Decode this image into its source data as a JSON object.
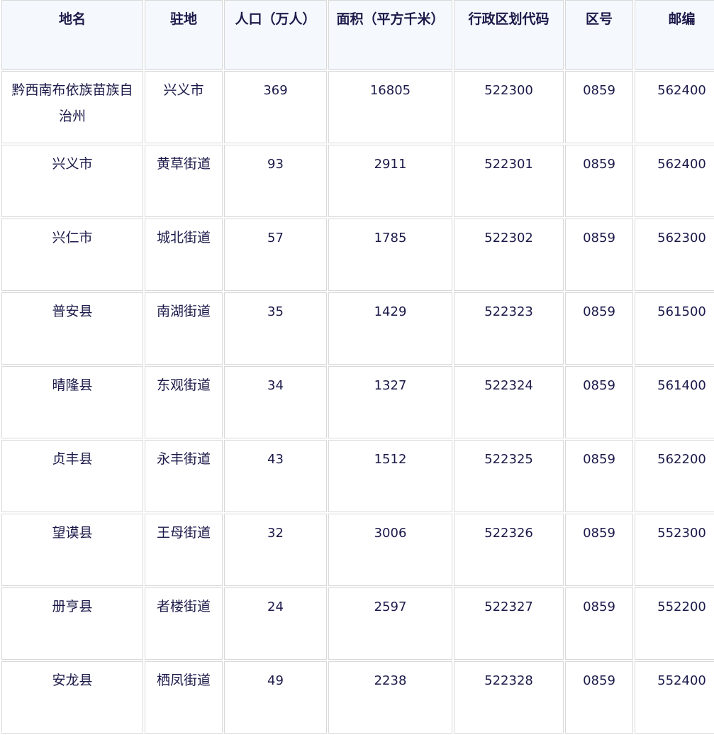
{
  "table": {
    "columns": [
      "地名",
      "驻地",
      "人口（万人）",
      "面积（平方千米）",
      "行政区划代码",
      "区号",
      "邮编"
    ],
    "rows": [
      [
        "黔西南布依族苗族自治州",
        "兴义市",
        "369",
        "16805",
        "522300",
        "0859",
        "562400"
      ],
      [
        "兴义市",
        "黄草街道",
        "93",
        "2911",
        "522301",
        "0859",
        "562400"
      ],
      [
        "兴仁市",
        "城北街道",
        "57",
        "1785",
        "522302",
        "0859",
        "562300"
      ],
      [
        "普安县",
        "南湖街道",
        "35",
        "1429",
        "522323",
        "0859",
        "561500"
      ],
      [
        "晴隆县",
        "东观街道",
        "34",
        "1327",
        "522324",
        "0859",
        "561400"
      ],
      [
        "贞丰县",
        "永丰街道",
        "43",
        "1512",
        "522325",
        "0859",
        "562200"
      ],
      [
        "望谟县",
        "王母街道",
        "32",
        "3006",
        "522326",
        "0859",
        "552300"
      ],
      [
        "册亨县",
        "者楼街道",
        "24",
        "2597",
        "522327",
        "0859",
        "552200"
      ],
      [
        "安龙县",
        "栖凤街道",
        "49",
        "2238",
        "522328",
        "0859",
        "552400"
      ]
    ]
  }
}
